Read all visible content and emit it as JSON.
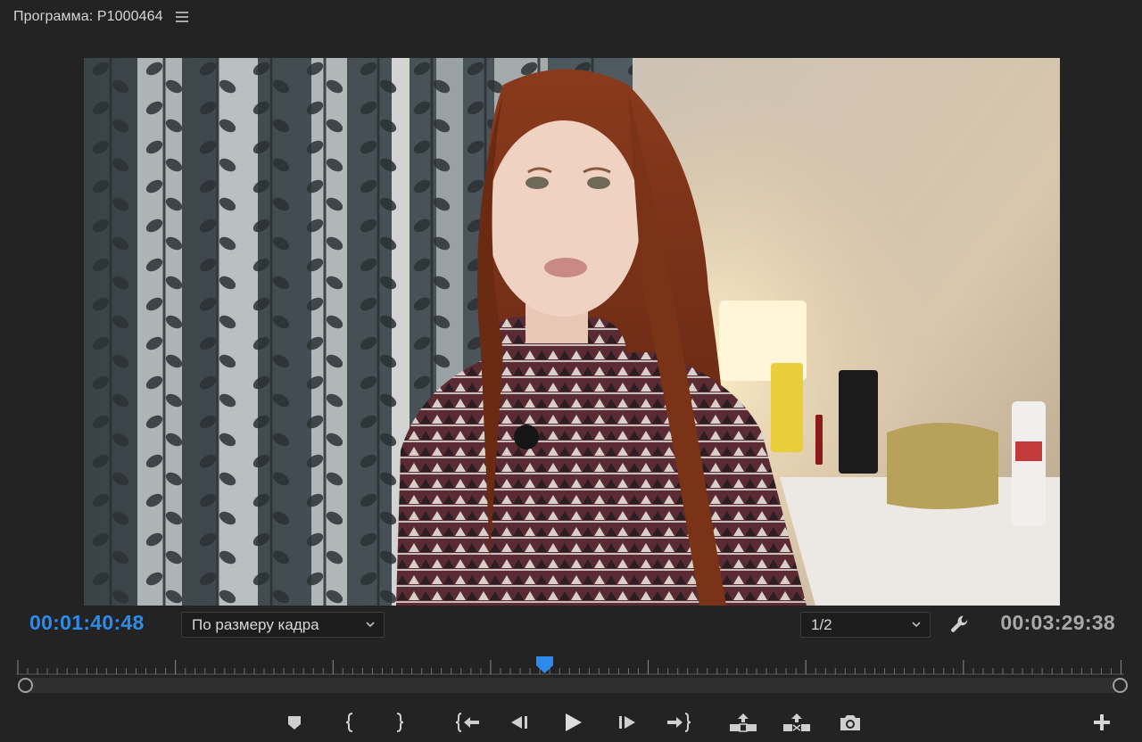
{
  "panel": {
    "title": "Программа: P1000464"
  },
  "timecode": {
    "current": "00:01:40:48",
    "duration": "00:03:29:38"
  },
  "zoom": {
    "selected": "По размеру кадра"
  },
  "resolution": {
    "selected": "1/2"
  },
  "playhead_fraction": 0.477,
  "icons": {
    "menu": "hamburger-icon",
    "settings": "wrench-icon",
    "marker": "add-marker-icon",
    "mark_in": "mark-in-icon",
    "mark_out": "mark-out-icon",
    "go_in": "go-to-in-icon",
    "step_back": "step-back-icon",
    "play": "play-icon",
    "step_forward": "step-forward-icon",
    "go_out": "go-to-out-icon",
    "lift": "lift-icon",
    "extract": "extract-icon",
    "export_frame": "camera-icon",
    "add_button": "plus-icon"
  },
  "colors": {
    "accent": "#2d8ceb",
    "background": "#232323"
  }
}
